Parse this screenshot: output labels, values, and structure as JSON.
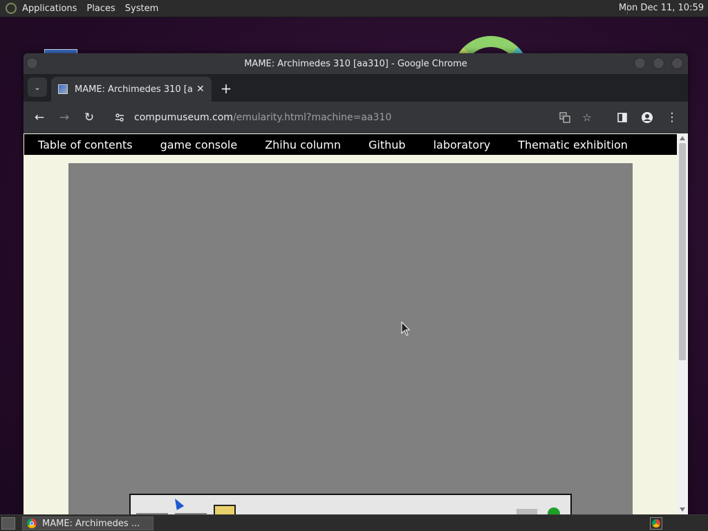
{
  "top_panel": {
    "menus": [
      "Applications",
      "Places",
      "System"
    ],
    "clock": "Mon Dec 11, 10:59"
  },
  "window": {
    "title": "MAME: Archimedes 310 [aa310] - Google Chrome"
  },
  "tabs": [
    {
      "title": "MAME: Archimedes 310 [aa3",
      "close": "✕"
    }
  ],
  "toolbar": {
    "url_host": "compumuseum.com",
    "url_path": "/emularity.html?machine=aa310",
    "back": "←",
    "forward": "→",
    "reload": "↻",
    "new_tab": "+",
    "tab_menu": "⌄",
    "menu_dots": "⋮"
  },
  "site_nav": {
    "links": [
      "Table of contents",
      "game console",
      "Zhihu column",
      "Github",
      "laboratory",
      "Thematic exhibition"
    ]
  },
  "taskbar": {
    "task_label": "MAME: Archimedes ..."
  },
  "colors": {
    "page_bg": "#f4f4e2",
    "nav_bg": "#000000",
    "emulator_bg": "#808080",
    "chrome_dark": "#35363a"
  },
  "icons": [
    "menu-logo-icon",
    "tab-search-icon",
    "favicon-icon",
    "close-icon",
    "plus-icon",
    "back-arrow-icon",
    "forward-arrow-icon",
    "reload-icon",
    "site-info-icon",
    "translate-icon",
    "bookmark-star-icon",
    "side-panel-icon",
    "profile-icon",
    "kebab-menu-icon",
    "chrome-icon",
    "mouse-pointer-icon"
  ]
}
